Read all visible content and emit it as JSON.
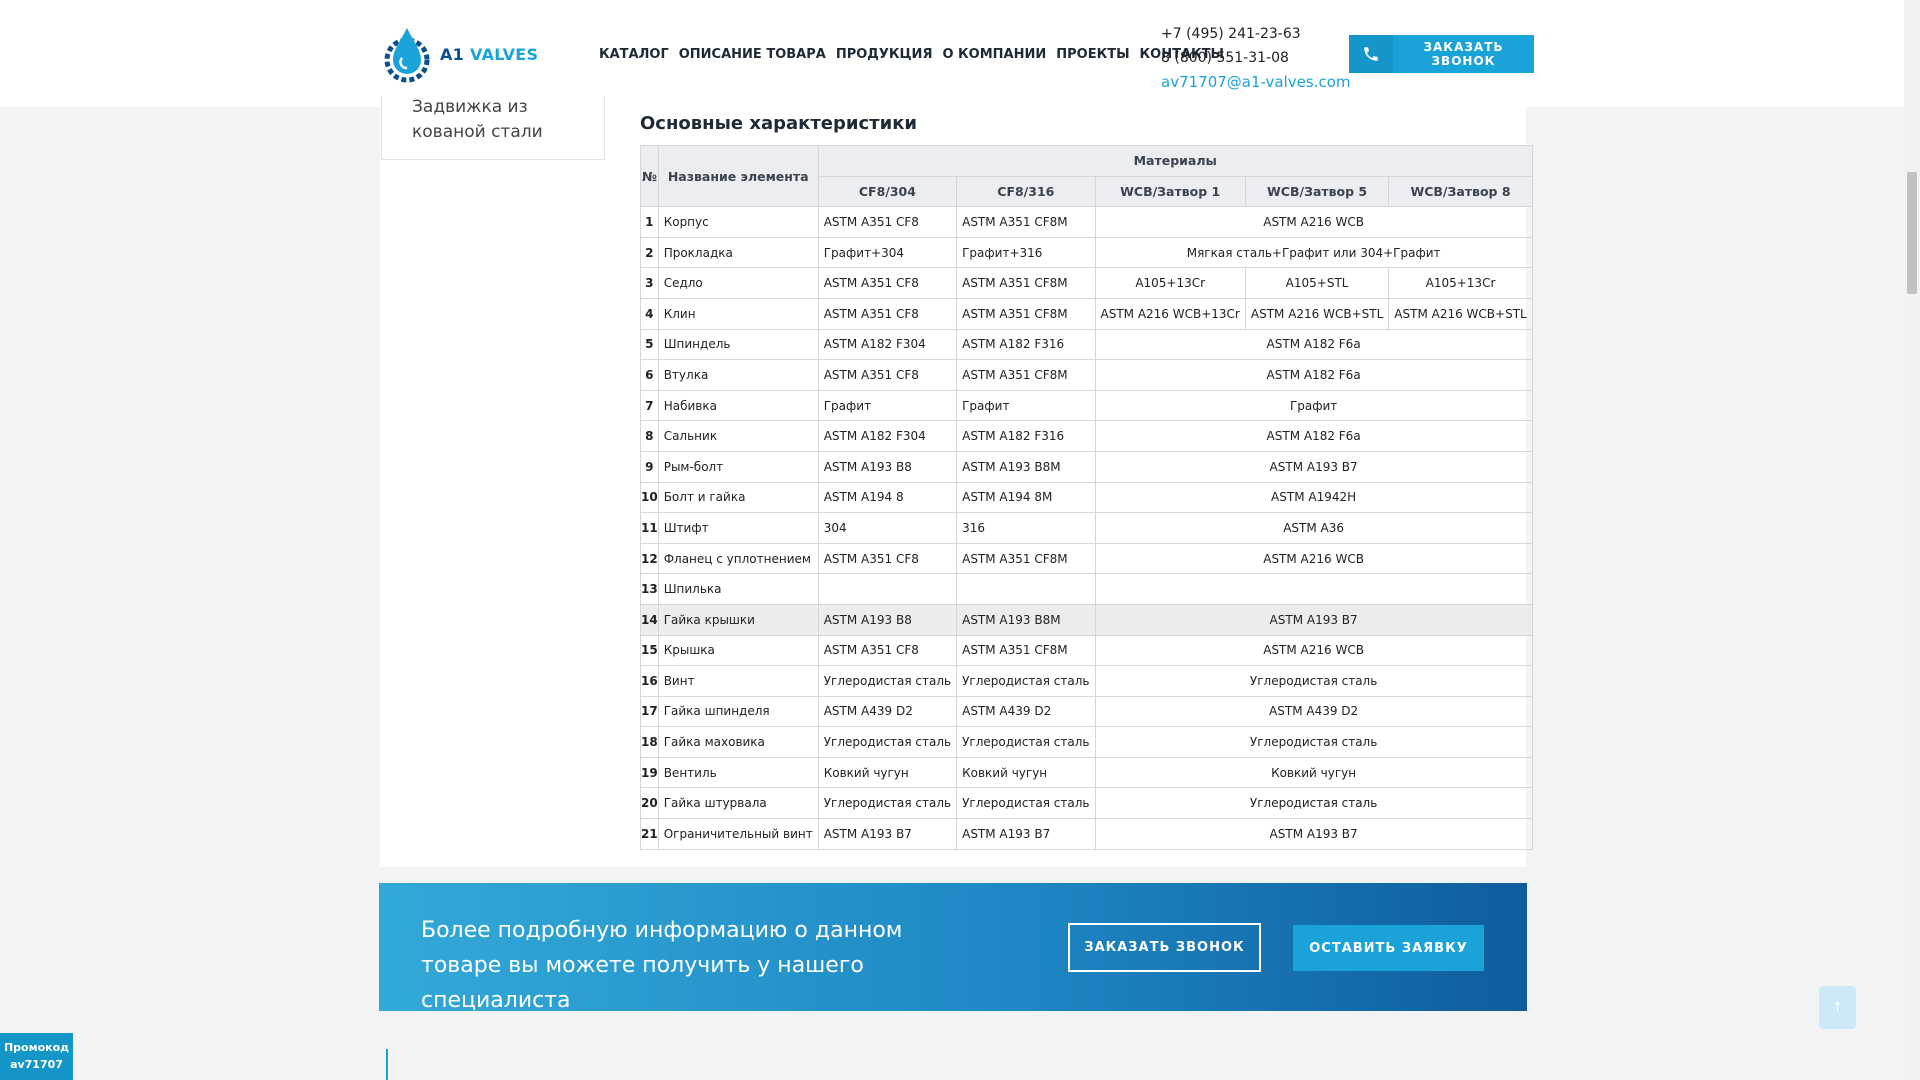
{
  "header": {
    "logo_text_a": "A1",
    "logo_text_b": " VALVES",
    "nav": [
      "КАТАЛОГ",
      "ОПИСАНИЕ ТОВАРА",
      "ПРОДУКЦИЯ",
      "О КОМПАНИИ",
      "ПРОЕКТЫ",
      "КОНТАКТЫ"
    ],
    "phone1": "+7 (495) 241-23-63",
    "phone2": "8 (800) 551-31-08",
    "email": "av71707@a1-valves.com",
    "call_button": "ЗАКАЗАТЬ ЗВОНОК"
  },
  "sidebar": {
    "item_line1": "Задвижка из",
    "item_line2": "кованой стали"
  },
  "section_title": "Основные характеристики",
  "table": {
    "h_num": "№",
    "h_name": "Название элемента",
    "h_materials": "Материалы",
    "h_cols": [
      "CF8/304",
      "CF8/316",
      "WCB/Затвор 1",
      "WCB/Затвор 5",
      "WCB/Затвор 8"
    ],
    "rows": [
      {
        "n": "1",
        "name": "Корпус",
        "a": "ASTM A351 CF8",
        "b": "ASTM A351 CF8M",
        "wcb": "ASTM A216 WCB"
      },
      {
        "n": "2",
        "name": "Прокладка",
        "a": "Графит+304",
        "b": "Графит+316",
        "wcb": "Мягкая сталь+Графит или 304+Графит"
      },
      {
        "n": "3",
        "name": "Седло",
        "a": "ASTM A351 CF8",
        "b": "ASTM A351 CF8M",
        "w1": "A105+13Cr",
        "w5": "A105+STL",
        "w8": "A105+13Cr"
      },
      {
        "n": "4",
        "name": "Клин",
        "a": "ASTM A351 CF8",
        "b": "ASTM A351 CF8M",
        "w1": "ASTM A216 WCB+13Cr",
        "w5": "ASTM A216 WCB+STL",
        "w8": "ASTM A216 WCB+STL"
      },
      {
        "n": "5",
        "name": "Шпиндель",
        "a": "ASTM A182 F304",
        "b": "ASTM A182 F316",
        "wcb": "ASTM A182 F6a"
      },
      {
        "n": "6",
        "name": "Втулка",
        "a": "ASTM A351 CF8",
        "b": "ASTM A351 CF8M",
        "wcb": "ASTM A182 F6a"
      },
      {
        "n": "7",
        "name": "Набивка",
        "a": "Графит",
        "b": "Графит",
        "wcb": "Графит"
      },
      {
        "n": "8",
        "name": "Сальник",
        "a": "ASTM A182 F304",
        "b": "ASTM A182 F316",
        "wcb": "ASTM A182 F6a"
      },
      {
        "n": "9",
        "name": "Рым-болт",
        "a": "ASTM A193 B8",
        "b": "ASTM A193 B8M",
        "wcb": "ASTM A193 B7"
      },
      {
        "n": "10",
        "name": "Болт и гайка",
        "a": "ASTM A194 8",
        "b": "ASTM A194 8M",
        "wcb": "ASTM A1942H"
      },
      {
        "n": "11",
        "name": "Штифт",
        "a": "304",
        "b": "316",
        "wcb": "ASTM A36"
      },
      {
        "n": "12",
        "name": "Фланец с уплотнением",
        "a": "ASTM A351 CF8",
        "b": "ASTM A351 CF8M",
        "wcb": "ASTM A216 WCB"
      },
      {
        "n": "13",
        "name": "Шпилька",
        "a": "",
        "b": "",
        "wcb": ""
      },
      {
        "n": "14",
        "name": "Гайка крышки",
        "a": "ASTM A193 B8",
        "b": "ASTM A193 B8M",
        "wcb": "ASTM A193 B7"
      },
      {
        "n": "15",
        "name": "Крышка",
        "a": "ASTM A351 CF8",
        "b": "ASTM A351 CF8M",
        "wcb": "ASTM A216 WCB"
      },
      {
        "n": "16",
        "name": "Винт",
        "a": "Углеродистая сталь",
        "b": "Углеродистая сталь",
        "wcb": "Углеродистая сталь"
      },
      {
        "n": "17",
        "name": "Гайка шпинделя",
        "a": "ASTM A439 D2",
        "b": "ASTM A439 D2",
        "wcb": "ASTM A439 D2"
      },
      {
        "n": "18",
        "name": "Гайка маховика",
        "a": "Углеродистая сталь",
        "b": "Углеродистая сталь",
        "wcb": "Углеродистая сталь"
      },
      {
        "n": "19",
        "name": "Вентиль",
        "a": "Ковкий чугун",
        "b": "Ковкий чугун",
        "wcb": "Ковкий чугун"
      },
      {
        "n": "20",
        "name": "Гайка штурвала",
        "a": "Углеродистая сталь",
        "b": "Углеродистая сталь",
        "wcb": "Углеродистая сталь"
      },
      {
        "n": "21",
        "name": "Ограничительный винт",
        "a": "ASTM A193 B7",
        "b": "ASTM A193 B7",
        "wcb": "ASTM A193 B7"
      }
    ]
  },
  "cta": {
    "text": "Более подробную информацию о данном товаре вы можете получить у нашего специалиста",
    "button1": "ЗАКАЗАТЬ ЗВОНОК",
    "button2": "ОСТАВИТЬ ЗАЯВКУ"
  },
  "to_top": "↑",
  "promo": {
    "line1": "Промокод",
    "line2": "av71707"
  },
  "colors": {
    "accent": "#1aa3d8",
    "brand_dark": "#0c4f8f"
  }
}
